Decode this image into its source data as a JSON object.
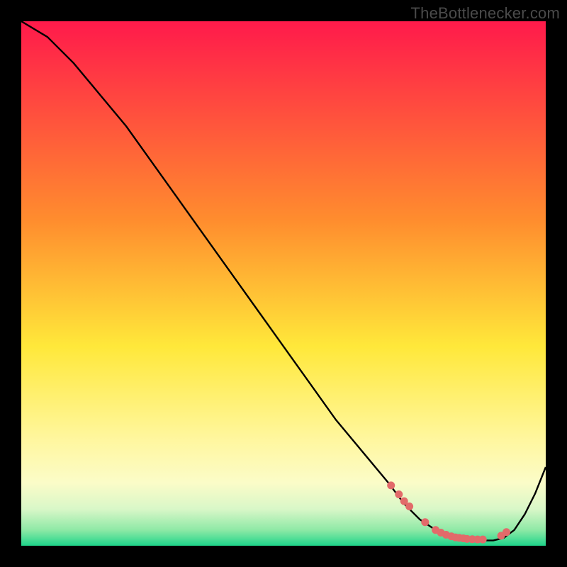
{
  "watermark": "TheBottlenecker.com",
  "colors": {
    "bg": "#000000",
    "curve": "#000000",
    "point": "#e26a6a",
    "grad_top": "#ff1a4b",
    "grad_mid_upper": "#ff8d2e",
    "grad_mid": "#ffe83a",
    "grad_low1": "#fff7a0",
    "grad_low2": "#fbfcc8",
    "grad_low3": "#d9f7c8",
    "grad_low4": "#8ee9a6",
    "grad_bottom": "#1fd48a"
  },
  "chart_data": {
    "type": "line",
    "title": "",
    "xlabel": "",
    "ylabel": "",
    "xlim": [
      0,
      100
    ],
    "ylim": [
      0,
      100
    ],
    "series": [
      {
        "name": "curve",
        "x": [
          0,
          5,
          10,
          15,
          20,
          25,
          30,
          35,
          40,
          45,
          50,
          55,
          60,
          65,
          70,
          73,
          76,
          79,
          82,
          85,
          88,
          90,
          92,
          94,
          96,
          98,
          100
        ],
        "y": [
          100,
          97,
          92,
          86,
          80,
          73,
          66,
          59,
          52,
          45,
          38,
          31,
          24,
          18,
          12,
          8,
          5,
          3,
          2,
          1.2,
          1,
          1,
          1.5,
          3,
          6,
          10,
          15
        ]
      }
    ],
    "highlight_points": {
      "name": "markers",
      "x": [
        70.5,
        72.0,
        73.0,
        74.0,
        77.0,
        79.0,
        80.0,
        81.0,
        82.0,
        82.8,
        83.5,
        84.3,
        85.0,
        86.0,
        87.0,
        88.0,
        91.5,
        92.5
      ],
      "y": [
        11.5,
        9.8,
        8.5,
        7.5,
        4.5,
        3.0,
        2.5,
        2.1,
        1.8,
        1.6,
        1.5,
        1.4,
        1.3,
        1.25,
        1.2,
        1.2,
        1.9,
        2.6
      ]
    }
  }
}
